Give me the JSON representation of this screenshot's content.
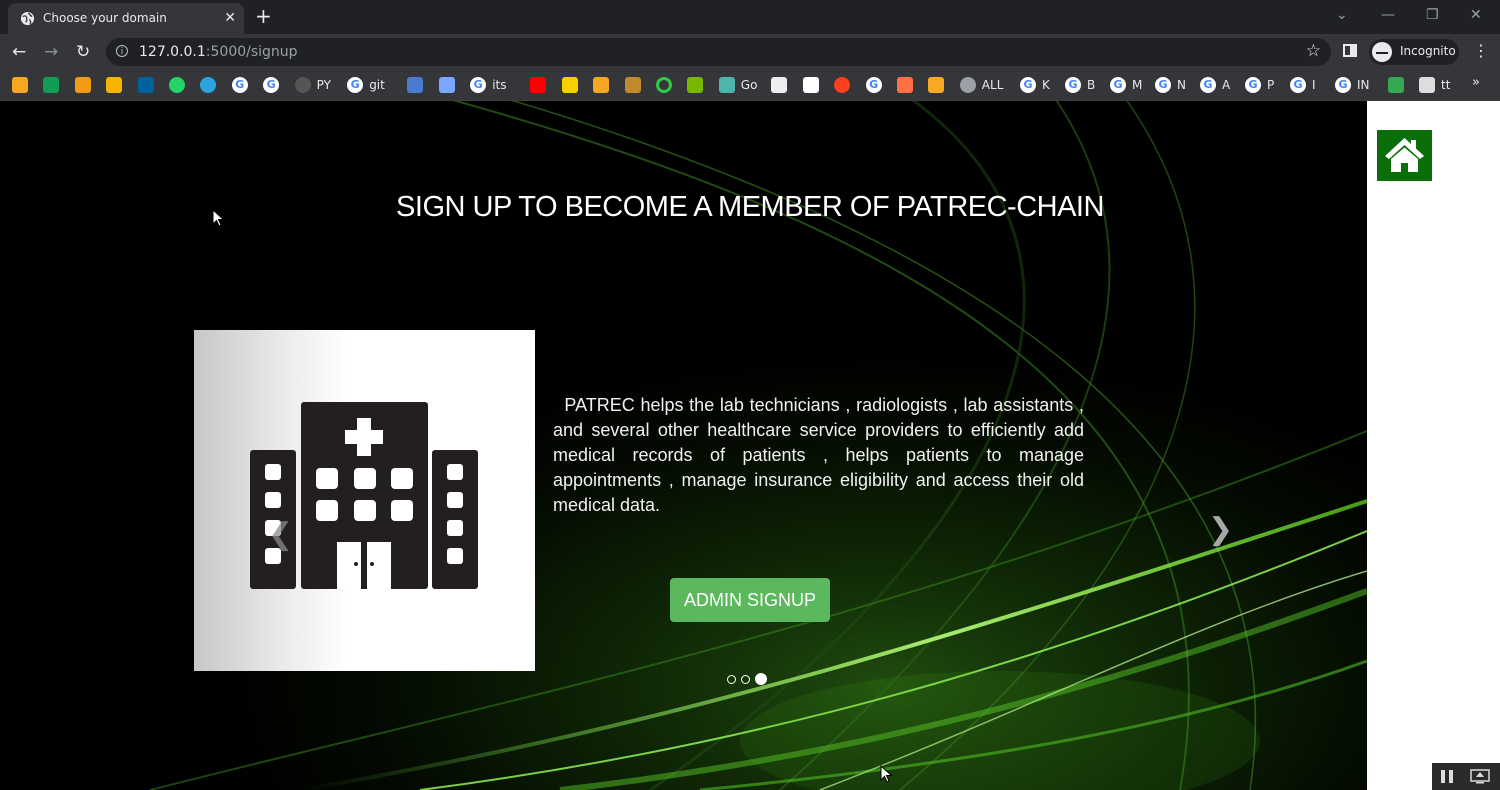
{
  "browser": {
    "tab_title": "Choose your domain",
    "new_tab_glyph": "+",
    "url_host": "127.0.0.1",
    "url_rest": ":5000/signup",
    "profile_label": "Incognito",
    "bookmarks": [
      {
        "icon": "orange-diamond",
        "label": ""
      },
      {
        "icon": "green-plus",
        "label": ""
      },
      {
        "icon": "orange-square",
        "label": ""
      },
      {
        "icon": "bar-chart",
        "label": ""
      },
      {
        "icon": "ieee",
        "label": ""
      },
      {
        "icon": "whatsapp",
        "label": ""
      },
      {
        "icon": "telegram",
        "label": ""
      },
      {
        "icon": "google",
        "label": ""
      },
      {
        "icon": "google",
        "label": ""
      },
      {
        "icon": "github",
        "label": "PY"
      },
      {
        "icon": "google",
        "label": "git"
      },
      {
        "icon": "calendar",
        "label": ""
      },
      {
        "icon": "car",
        "label": ""
      },
      {
        "icon": "google",
        "label": "its"
      },
      {
        "icon": "youtube",
        "label": ""
      },
      {
        "icon": "yellow-p",
        "label": ""
      },
      {
        "icon": "camera",
        "label": ""
      },
      {
        "icon": "shield",
        "label": ""
      },
      {
        "icon": "green-ring",
        "label": ""
      },
      {
        "icon": "nvidia",
        "label": ""
      },
      {
        "icon": "spiral",
        "label": "Go"
      },
      {
        "icon": "flag",
        "label": ""
      },
      {
        "icon": "cl",
        "label": ""
      },
      {
        "icon": "yandex",
        "label": ""
      },
      {
        "icon": "google",
        "label": ""
      },
      {
        "icon": "fire",
        "label": ""
      },
      {
        "icon": "note",
        "label": ""
      },
      {
        "icon": "globe",
        "label": "ALL"
      },
      {
        "icon": "google",
        "label": "K"
      },
      {
        "icon": "google",
        "label": "B"
      },
      {
        "icon": "google",
        "label": "M"
      },
      {
        "icon": "google",
        "label": "N"
      },
      {
        "icon": "google",
        "label": "A"
      },
      {
        "icon": "google",
        "label": "P"
      },
      {
        "icon": "google",
        "label": "I"
      },
      {
        "icon": "google",
        "label": "IN"
      },
      {
        "icon": "speaker",
        "label": ""
      },
      {
        "icon": "monitor",
        "label": "tt"
      }
    ],
    "more_bookmarks_glyph": "»"
  },
  "page": {
    "title": "SIGN UP TO BECOME A MEMBER OF PATREC-CHAIN",
    "description": "PATREC helps the lab technicians , radiologists , lab assistants , and several other healthcare service providers to efficiently add medical records of patients , helps patients to manage appointments , manage insurance eligibility and access their old medical data.",
    "admin_button_label": "ADMIN SIGNUP",
    "carousel": {
      "slide_count": 3,
      "active_index": 2
    }
  },
  "colors": {
    "hero_bg": "#000000",
    "button_green": "#5cb85c",
    "home_green": "#0a6e0a",
    "chrome_dark": "#202124",
    "chrome_toolbar": "#35363a"
  }
}
